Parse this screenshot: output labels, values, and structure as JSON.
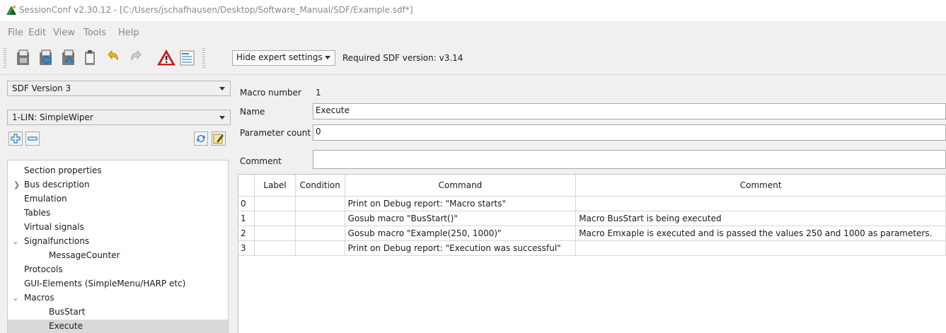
{
  "window": {
    "title": "SessionConf v2.30.12 - [C:/Users/jschafhausen/Desktop/Software_Manual/SDF/Example.sdf*]"
  },
  "menu": [
    "File",
    "Edit",
    "View",
    "Tools",
    "Help"
  ],
  "toolbar": {
    "buttons": [
      "new-file-icon",
      "open-file-icon",
      "save-file-icon",
      "clipboard-icon",
      "undo-icon",
      "redo-icon",
      "warning-icon",
      "edit-list-icon"
    ],
    "expert_select": "Hide expert settings",
    "required_version": "Required SDF version: v3.14"
  },
  "left": {
    "sdf_version": "SDF Version 3",
    "bus": "1-LIN: SimpleWiper",
    "tree": [
      {
        "label": "Section properties"
      },
      {
        "label": "Bus description"
      },
      {
        "label": "Emulation"
      },
      {
        "label": "Tables"
      },
      {
        "label": "Virtual signals"
      },
      {
        "label": "Signalfunctions"
      },
      {
        "label": "MessageCounter"
      },
      {
        "label": "Protocols"
      },
      {
        "label": "GUI-Elements (SimpleMenu/HARP etc)"
      },
      {
        "label": "Macros"
      },
      {
        "label": "BusStart"
      },
      {
        "label": "Execute"
      }
    ]
  },
  "form": {
    "macro_number_label": "Macro number",
    "macro_number": "1",
    "name_label": "Name",
    "name_value": "Execute",
    "param_label": "Parameter count",
    "param_value": "0",
    "comment_label": "Comment",
    "comment_value": ""
  },
  "table": {
    "headers": [
      "",
      "Label",
      "Condition",
      "Command",
      "Comment"
    ],
    "rows": [
      [
        "0",
        "",
        "",
        "Print on Debug report: \"Macro starts\"",
        ""
      ],
      [
        "1",
        "",
        "",
        "Gosub macro \"BusStart()\"",
        "Macro BusStart is being executed"
      ],
      [
        "2",
        "",
        "",
        "Gosub macro \"Example(250, 1000)\"",
        "Macro Emxaple is executed and is passed the values 250 and 1000 as parameters."
      ],
      [
        "3",
        "",
        "",
        "Print on Debug report: \"Execution was successful\"",
        ""
      ]
    ]
  }
}
